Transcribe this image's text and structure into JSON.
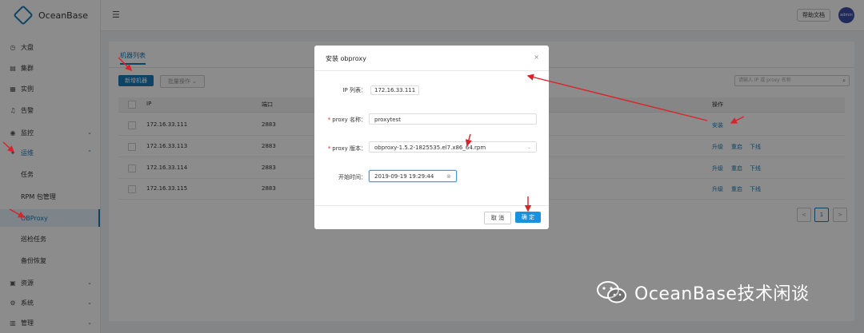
{
  "app": {
    "name": "OceanBase"
  },
  "sidebar": {
    "items": [
      {
        "icon": "dashboard-icon",
        "glyph": "◷",
        "label": "大盘"
      },
      {
        "icon": "cluster-icon",
        "glyph": "▤",
        "label": "集群"
      },
      {
        "icon": "instance-icon",
        "glyph": "▦",
        "label": "实例"
      },
      {
        "icon": "alarm-icon",
        "glyph": "♫",
        "label": "告警"
      },
      {
        "icon": "monitor-icon",
        "glyph": "◉",
        "label": "监控"
      },
      {
        "icon": "ops-icon",
        "glyph": "✦",
        "label": "运维"
      },
      {
        "label": "任务"
      },
      {
        "label": "RPM 包管理"
      },
      {
        "label": "OBProxy"
      },
      {
        "label": "巡检任务"
      },
      {
        "label": "备份恢复"
      },
      {
        "icon": "resource-icon",
        "glyph": "▣",
        "label": "资源"
      },
      {
        "icon": "system-icon",
        "glyph": "⚙",
        "label": "系统"
      },
      {
        "icon": "manage-icon",
        "glyph": "▥",
        "label": "管理"
      }
    ]
  },
  "header": {
    "help_label": "帮助文档",
    "avatar_label": "admin"
  },
  "main": {
    "tab_label": "机器列表",
    "add_button": "新增机器",
    "batch_button": "批量操作",
    "search_placeholder": "请输入 IP 或 proxy 名称",
    "columns": {
      "ip": "IP",
      "port": "端口",
      "action": "操作"
    },
    "rows": [
      {
        "ip": "172.16.33.111",
        "port": "2883",
        "actions": [
          "安装"
        ]
      },
      {
        "ip": "172.16.33.113",
        "port": "2883",
        "actions": [
          "升级",
          "重启",
          "下线"
        ]
      },
      {
        "ip": "172.16.33.114",
        "port": "2883",
        "actions": [
          "升级",
          "重启",
          "下线"
        ]
      },
      {
        "ip": "172.16.33.115",
        "port": "2883",
        "actions": [
          "升级",
          "重启",
          "下线"
        ]
      }
    ],
    "pager": {
      "prev": "<",
      "page": "1",
      "next": ">"
    }
  },
  "modal": {
    "title": "安装 obproxy",
    "close": "×",
    "ip_label": "IP 列表：",
    "ip_value": "172.16.33.111",
    "name_label": "proxy 名称：",
    "name_value": "proxytest",
    "version_label": "proxy 版本：",
    "version_value": "obproxy-1.5.2-1825535.el7.x86_64.rpm",
    "time_label": "开始时间：",
    "time_value": "2019-09-19 19:29:44",
    "cancel": "取 消",
    "ok": "确 定"
  },
  "watermark": {
    "text": "OceanBase技术闲谈"
  },
  "colors": {
    "accent": "#1a7ab8",
    "annotation": "#d8232a"
  }
}
